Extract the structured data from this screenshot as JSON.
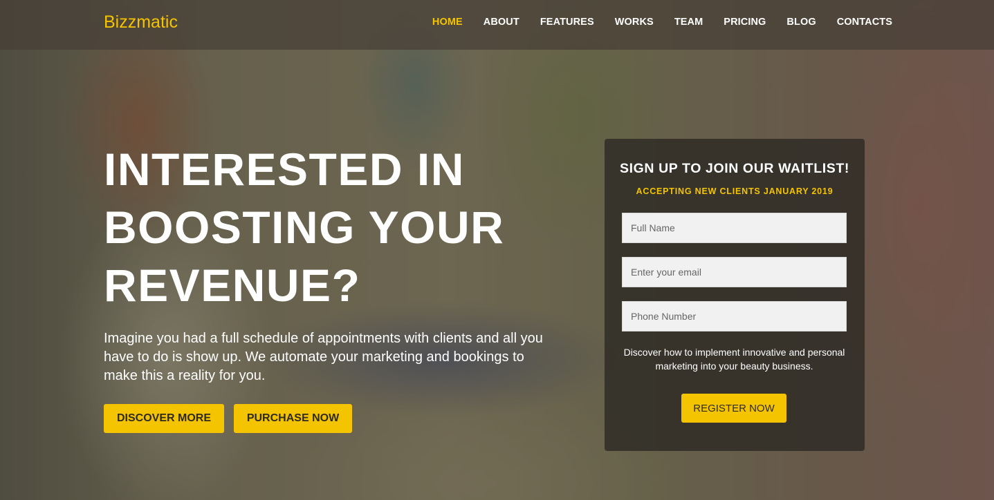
{
  "brand": {
    "name": "Bizzmatic"
  },
  "nav": {
    "items": [
      {
        "label": "HOME",
        "active": true
      },
      {
        "label": "ABOUT",
        "active": false
      },
      {
        "label": "FEATURES",
        "active": false
      },
      {
        "label": "WORKS",
        "active": false
      },
      {
        "label": "TEAM",
        "active": false
      },
      {
        "label": "PRICING",
        "active": false
      },
      {
        "label": "BLOG",
        "active": false
      },
      {
        "label": "CONTACTS",
        "active": false
      }
    ]
  },
  "hero": {
    "headline_lines": [
      "INTERESTED IN",
      "BOOSTING YOUR",
      "REVENUE?"
    ],
    "subtext": "Imagine you had a full schedule of appointments with clients and all you have to do is show up. We automate your marketing and bookings to make this a reality for you.",
    "discover_label": "DISCOVER MORE",
    "purchase_label": "PURCHASE NOW"
  },
  "signup": {
    "title": "SIGN UP TO JOIN OUR WAITLIST!",
    "subtitle": "ACCEPTING NEW CLIENTS JANUARY 2019",
    "fields": {
      "name_placeholder": "Full Name",
      "email_placeholder": "Enter your email",
      "phone_placeholder": "Phone Number"
    },
    "description": "Discover how to implement innovative and personal marketing into your beauty business.",
    "register_label": "REGISTER NOW"
  },
  "colors": {
    "accent": "#f5c400",
    "navbar": "#463e36",
    "card": "#302c26",
    "text": "#ffffff"
  }
}
